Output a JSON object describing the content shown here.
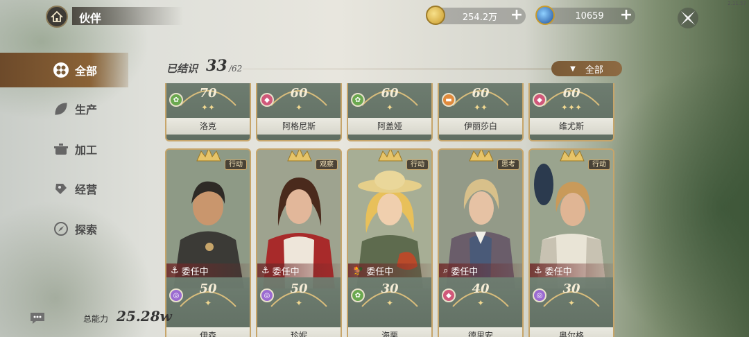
{
  "app": {
    "version": "2.11.57"
  },
  "header": {
    "title": "伙伴",
    "currencies": [
      {
        "icon": "coin-icon",
        "value": "254.2万",
        "color": "#d8b24a"
      },
      {
        "icon": "gem-icon",
        "value": "10659",
        "color": "#2e76c9"
      }
    ]
  },
  "sidebar": {
    "items": [
      {
        "label": "全部",
        "icon": "all-grid-icon",
        "active": true
      },
      {
        "label": "生产",
        "icon": "leaf-icon",
        "active": false
      },
      {
        "label": "加工",
        "icon": "pot-icon",
        "active": false
      },
      {
        "label": "经营",
        "icon": "coin-stack-icon",
        "active": false
      },
      {
        "label": "探索",
        "icon": "compass-icon",
        "active": false
      }
    ]
  },
  "collection": {
    "label": "已结识",
    "owned": "33",
    "total": "/62",
    "filter_label": "全部"
  },
  "cards_top": [
    {
      "name": "洛克",
      "level": "70",
      "stars": "✦✦",
      "type": "production",
      "type_color": "#6aa84f"
    },
    {
      "name": "阿格尼斯",
      "level": "60",
      "stars": "✦",
      "type": "business",
      "type_color": "#d0587a"
    },
    {
      "name": "阿盖娅",
      "level": "60",
      "stars": "✦",
      "type": "production",
      "type_color": "#6aa84f"
    },
    {
      "name": "伊丽莎白",
      "level": "60",
      "stars": "✦✦",
      "type": "processing",
      "type_color": "#e08a3c"
    },
    {
      "name": "维尤斯",
      "level": "60",
      "stars": "✦✦✦",
      "type": "business",
      "type_color": "#d0587a"
    }
  ],
  "cards_bottom": [
    {
      "name": "伊森",
      "level": "50",
      "stars": "✦",
      "tag": "行动",
      "assign": "委任中",
      "type": "explore",
      "type_color": "#9b6bd1",
      "hair": "#2e2a26",
      "coat": "#3b3a36",
      "skin": "#c9966d"
    },
    {
      "name": "珍妮",
      "level": "50",
      "stars": "✦",
      "tag": "观察",
      "assign": "委任中",
      "type": "explore",
      "type_color": "#9b6bd1",
      "hair": "#4a2a1c",
      "coat": "#a82a2a",
      "skin": "#e2b79a"
    },
    {
      "name": "海栗",
      "level": "30",
      "stars": "✦",
      "tag": "行动",
      "assign": "委任中",
      "type": "production",
      "type_color": "#6aa84f",
      "hair": "#e8c05a",
      "coat": "#5e6b4e",
      "skin": "#f0cfae"
    },
    {
      "name": "德里安",
      "level": "40",
      "stars": "✦",
      "tag": "思考",
      "assign": "委任中",
      "type": "business",
      "type_color": "#d0587a",
      "hair": "#d8c08a",
      "coat": "#4a5a78",
      "skin": "#e6c2a4"
    },
    {
      "name": "奥尔格",
      "level": "30",
      "stars": "✦",
      "tag": "行动",
      "assign": "委任中",
      "type": "explore",
      "type_color": "#9b6bd1",
      "hair": "#c99a5a",
      "coat": "#5c6e5a",
      "skin": "#e0b594"
    }
  ],
  "footer": {
    "power_label": "总能力",
    "power_value": "25.28w"
  }
}
